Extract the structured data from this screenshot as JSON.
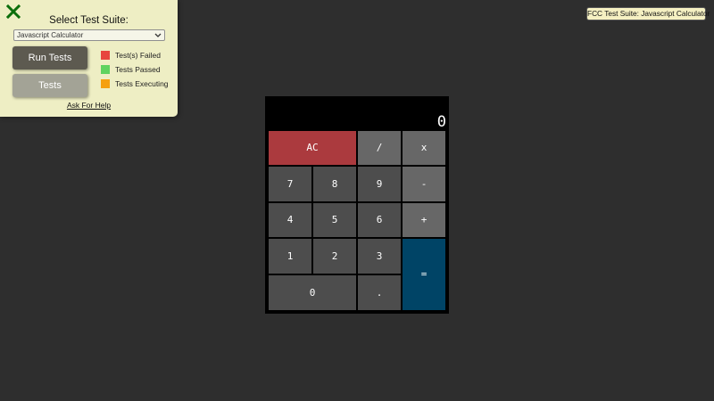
{
  "panel": {
    "title": "Select Test Suite:",
    "selected_suite": "Javascript Calculator",
    "run_button": "Run Tests",
    "tests_button": "Tests",
    "legend": {
      "failed": "Test(s) Failed",
      "passed": "Tests Passed",
      "executing": "Tests Executing"
    },
    "help_link": "Ask For Help"
  },
  "badge": "FCC Test Suite: Javascript Calculator",
  "calculator": {
    "display": "0",
    "keys": {
      "clear": "AC",
      "divide": "/",
      "multiply": "x",
      "seven": "7",
      "eight": "8",
      "nine": "9",
      "subtract": "-",
      "four": "4",
      "five": "5",
      "six": "6",
      "add": "+",
      "one": "1",
      "two": "2",
      "three": "3",
      "equals": "=",
      "zero": "0",
      "decimal": "."
    }
  },
  "colors": {
    "background": "#2e2e2e",
    "panel": "#eeeec4",
    "failed": "#e7463e",
    "passed": "#5fd35f",
    "executing": "#f5a00f",
    "clear_key": "#ab3a3e",
    "equals_key": "#004466",
    "number_key": "#4d4d4d",
    "operator_key": "#676767"
  },
  "icons": {
    "close": "close-icon",
    "select_chevron": "chevron-down-icon"
  }
}
